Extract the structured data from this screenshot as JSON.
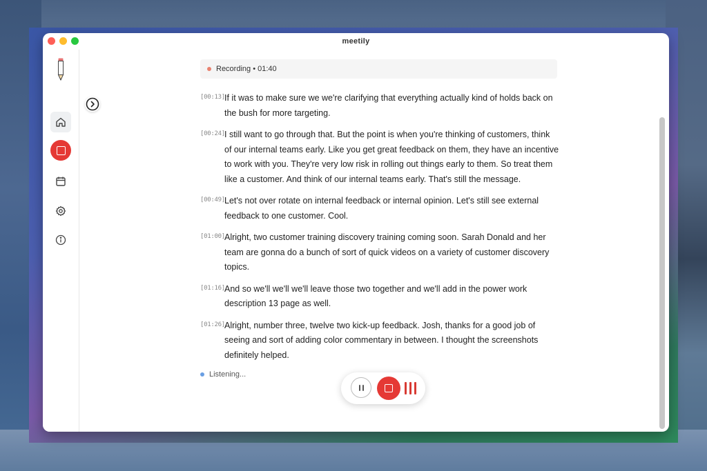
{
  "app": {
    "title": "meetily"
  },
  "sidebar": {
    "items": [
      {
        "name": "home",
        "icon": "home-icon"
      },
      {
        "name": "record",
        "icon": "stop-square-icon"
      },
      {
        "name": "calendar",
        "icon": "calendar-icon"
      },
      {
        "name": "settings",
        "icon": "gear-icon"
      },
      {
        "name": "info",
        "icon": "info-icon"
      }
    ]
  },
  "status": {
    "text": "Recording • 01:40",
    "dot_color": "#e9826f"
  },
  "transcript": [
    {
      "time": "[00:13]",
      "text": "If it was to make sure we we're clarifying that everything actually kind of holds back on the bush for more targeting."
    },
    {
      "time": "[00:24]",
      "text": "I still want to go through that. But the point is when you're thinking of customers, think of our internal teams early. Like you get great feedback on them, they have an incentive to work with you. They're very low risk in rolling out things early to them. So treat them like a customer. And think of our internal teams early. That's still the message."
    },
    {
      "time": "[00:49]",
      "text": "Let's not over rotate on internal feedback or internal opinion. Let's still see external feedback to one customer. Cool."
    },
    {
      "time": "[01:00]",
      "text": "Alright, two customer training discovery training coming soon. Sarah Donald and her team are gonna do a bunch of sort of quick videos on a variety of customer discovery topics."
    },
    {
      "time": "[01:16]",
      "text": "And so we'll we'll we'll leave those two together and we'll add in the power work description 13 page as well."
    },
    {
      "time": "[01:26]",
      "text": "Alright, number three, twelve two kick-up feedback. Josh, thanks for a good job of seeing and sort of adding color commentary in between. I thought the screenshots definitely helped."
    }
  ],
  "listening": {
    "text": "Listening...",
    "dot_color": "#6a9fe3"
  },
  "colors": {
    "accent_red": "#e53935"
  }
}
